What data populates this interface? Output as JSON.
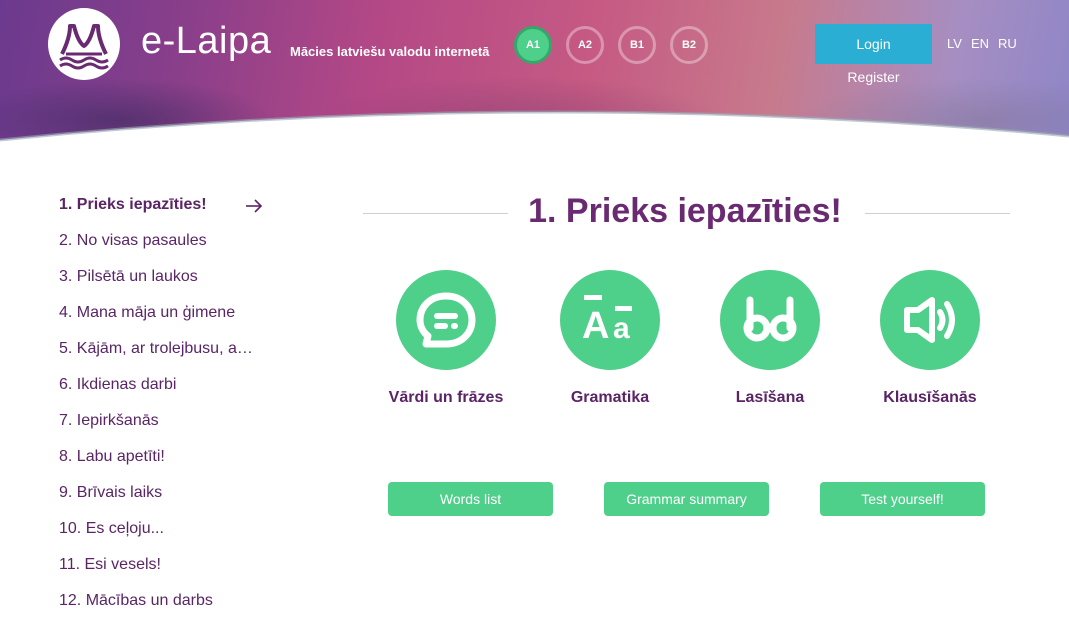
{
  "header": {
    "brand": "e-Laipa",
    "tagline": "Mācies latviešu valodu internetā",
    "levels": [
      {
        "label": "A1",
        "active": true
      },
      {
        "label": "A2",
        "active": false
      },
      {
        "label": "B1",
        "active": false
      },
      {
        "label": "B2",
        "active": false
      }
    ],
    "login_label": "Login",
    "register_label": "Register",
    "languages": [
      "LV",
      "EN",
      "RU"
    ]
  },
  "sidebar": {
    "items": [
      {
        "label": "1. Prieks iepazīties!",
        "active": true
      },
      {
        "label": "2. No visas pasaules"
      },
      {
        "label": "3. Pilsētā un laukos"
      },
      {
        "label": "4. Mana māja un ģimene"
      },
      {
        "label": "5. Kājām, ar trolejbusu, ar ..."
      },
      {
        "label": "6. Ikdienas darbi"
      },
      {
        "label": "7. Iepirkšanās"
      },
      {
        "label": "8. Labu apetīti!"
      },
      {
        "label": "9. Brīvais laiks"
      },
      {
        "label": "10. Es ceļoju..."
      },
      {
        "label": "11. Esi vesels!"
      },
      {
        "label": "12. Mācības un darbs"
      }
    ]
  },
  "main": {
    "title": "1. Prieks iepazīties!",
    "sections": [
      {
        "label": "Vārdi un frāzes",
        "icon": "chat-bubble-icon"
      },
      {
        "label": "Gramatika",
        "icon": "grammar-letters-icon"
      },
      {
        "label": "Lasīšana",
        "icon": "reading-glasses-icon"
      },
      {
        "label": "Klausīšanās",
        "icon": "speaker-icon"
      }
    ],
    "buttons": {
      "words_list": "Words list",
      "grammar_summary": "Grammar summary",
      "test_yourself": "Test yourself!"
    }
  },
  "colors": {
    "accent_green": "#4ecf8a",
    "login_blue": "#2aaed3",
    "text_purple": "#5a2466"
  }
}
